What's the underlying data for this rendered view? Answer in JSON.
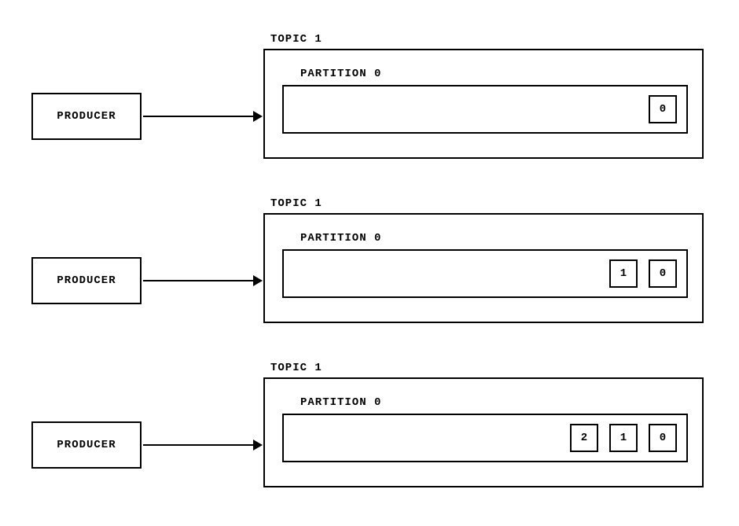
{
  "rows": [
    {
      "producer_label": "PRODUCER",
      "topic_label": "TOPIC 1",
      "partition_label": "PARTITION 0",
      "messages": [
        "0"
      ]
    },
    {
      "producer_label": "PRODUCER",
      "topic_label": "TOPIC 1",
      "partition_label": "PARTITION 0",
      "messages": [
        "1",
        "0"
      ]
    },
    {
      "producer_label": "PRODUCER",
      "topic_label": "TOPIC 1",
      "partition_label": "PARTITION 0",
      "messages": [
        "2",
        "1",
        "0"
      ]
    }
  ]
}
